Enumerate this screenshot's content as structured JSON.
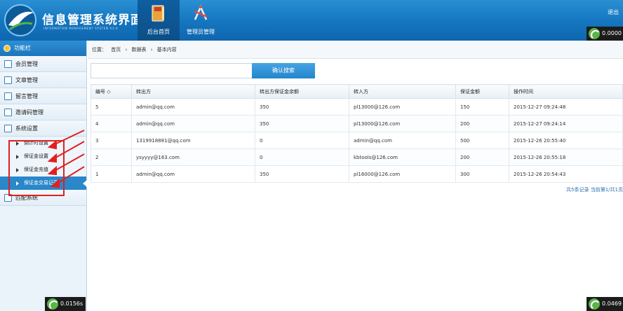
{
  "header": {
    "title": "信息管理系统界面",
    "subtitle": "INFORMATION MANAGEMENT SYSTEM V3.0",
    "nav": [
      {
        "label": "后台首页",
        "icon": "book-icon",
        "active": true
      },
      {
        "label": "管理员管理",
        "icon": "tools-icon",
        "active": false
      }
    ],
    "logout": "退出",
    "speed_top": "0.0000"
  },
  "sidebar": {
    "heading": "功能栏",
    "items": [
      {
        "label": "会员管理",
        "icon": "member-icon"
      },
      {
        "label": "文章管理",
        "icon": "article-icon"
      },
      {
        "label": "留言管理",
        "icon": "message-icon"
      },
      {
        "label": "邀请码管理",
        "icon": "invite-icon"
      },
      {
        "label": "系统设置",
        "icon": "settings-icon"
      }
    ],
    "sub_items": [
      {
        "label": "倒计时设置",
        "active": false
      },
      {
        "label": "保证金设置",
        "active": false
      },
      {
        "label": "保证金充值",
        "active": false
      },
      {
        "label": "保证金交易记录",
        "active": true
      }
    ],
    "extra_item": {
      "label": "匹配系统",
      "icon": "match-icon"
    },
    "speed_bottom": "0.0156s"
  },
  "main": {
    "breadcrumb": {
      "prefix": "位置：",
      "items": [
        "首页",
        "数据表",
        "基本内容"
      ],
      "sep": "›"
    },
    "search": {
      "value": "",
      "button": "确认搜索"
    },
    "table": {
      "columns": [
        "编号 ◇",
        "转出方",
        "转出方保证金余额",
        "转入方",
        "保证金额",
        "操作时间"
      ],
      "rows": [
        [
          "5",
          "admin@qq.com",
          "350",
          "pl13000@126.com",
          "150",
          "2015-12-27 09:24:48"
        ],
        [
          "4",
          "admin@qq.com",
          "350",
          "pl13000@126.com",
          "200",
          "2015-12-27 09:24:14"
        ],
        [
          "3",
          "1319918881@qq.com",
          "0",
          "admin@qq.com",
          "500",
          "2015-12-26 20:55:40"
        ],
        [
          "2",
          "ysyyyy@163.com",
          "0",
          "kbtools@126.com",
          "200",
          "2015-12-26 20:55:18"
        ],
        [
          "1",
          "admin@qq.com",
          "350",
          "pl16000@126.com",
          "300",
          "2015-12-26 20:54:43"
        ]
      ]
    },
    "pager": "共5条记录 当前第1/共1页",
    "speed_right": "0.0469"
  },
  "colors": {
    "header": "#1475bf",
    "active_sub": "#2a87c9",
    "annotation": "#e02020"
  }
}
